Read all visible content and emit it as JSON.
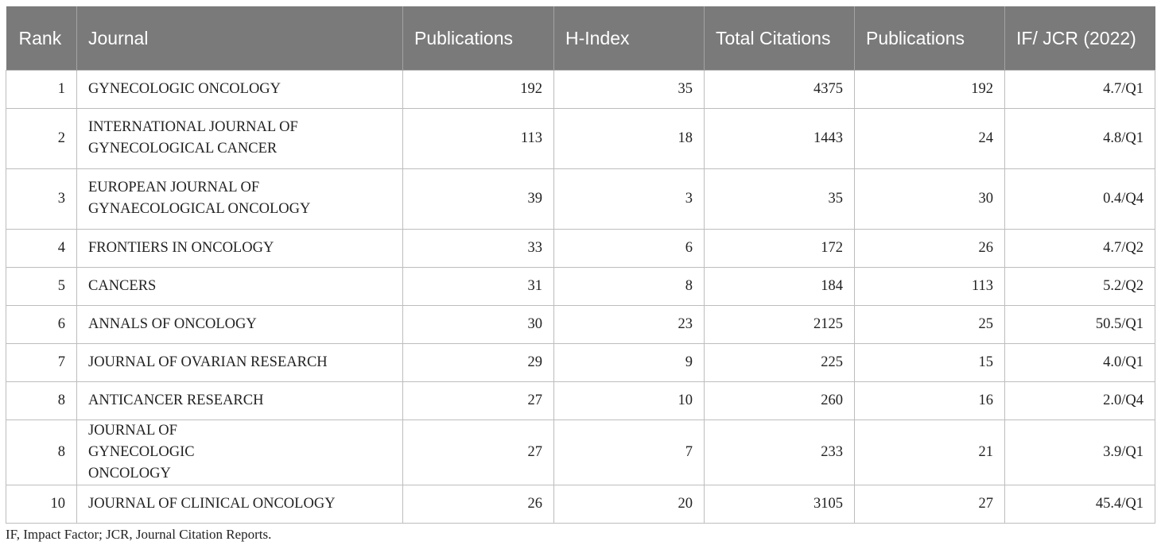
{
  "table": {
    "headers": [
      "Rank",
      "Journal",
      "Publications",
      "H-Index",
      "Total Citations",
      "Publications",
      "IF/ JCR (2022)"
    ],
    "rows": [
      {
        "rank": "1",
        "journal": "GYNECOLOGIC ONCOLOGY",
        "publications": "192",
        "h_index": "35",
        "total_citations": "4375",
        "publications2": "192",
        "if_jcr": "4.7/Q1"
      },
      {
        "rank": "2",
        "journal": "INTERNATIONAL JOURNAL OF GYNECOLOGICAL CANCER",
        "publications": "113",
        "h_index": "18",
        "total_citations": "1443",
        "publications2": "24",
        "if_jcr": "4.8/Q1"
      },
      {
        "rank": "3",
        "journal": "EUROPEAN JOURNAL OF GYNAECOLOGICAL ONCOLOGY",
        "publications": "39",
        "h_index": "3",
        "total_citations": "35",
        "publications2": "30",
        "if_jcr": "0.4/Q4"
      },
      {
        "rank": "4",
        "journal": "FRONTIERS IN ONCOLOGY",
        "publications": "33",
        "h_index": "6",
        "total_citations": "172",
        "publications2": "26",
        "if_jcr": "4.7/Q2"
      },
      {
        "rank": "5",
        "journal": "CANCERS",
        "publications": "31",
        "h_index": "8",
        "total_citations": "184",
        "publications2": "113",
        "if_jcr": "5.2/Q2"
      },
      {
        "rank": "6",
        "journal": "ANNALS OF ONCOLOGY",
        "publications": "30",
        "h_index": "23",
        "total_citations": "2125",
        "publications2": "25",
        "if_jcr": "50.5/Q1"
      },
      {
        "rank": "7",
        "journal": "JOURNAL OF OVARIAN RESEARCH",
        "publications": "29",
        "h_index": "9",
        "total_citations": "225",
        "publications2": "15",
        "if_jcr": "4.0/Q1"
      },
      {
        "rank": "8",
        "journal": "ANTICANCER RESEARCH",
        "publications": "27",
        "h_index": "10",
        "total_citations": "260",
        "publications2": "16",
        "if_jcr": "2.0/Q4"
      },
      {
        "rank": "8",
        "journal": "JOURNAL OF GYNECOLOGIC ONCOLOGY",
        "publications": "27",
        "h_index": "7",
        "total_citations": "233",
        "publications2": "21",
        "if_jcr": "3.9/Q1"
      },
      {
        "rank": "10",
        "journal": "JOURNAL OF CLINICAL ONCOLOGY",
        "publications": "26",
        "h_index": "20",
        "total_citations": "3105",
        "publications2": "27",
        "if_jcr": "45.4/Q1"
      }
    ]
  },
  "footnote": "IF, Impact Factor; JCR, Journal Citation Reports."
}
